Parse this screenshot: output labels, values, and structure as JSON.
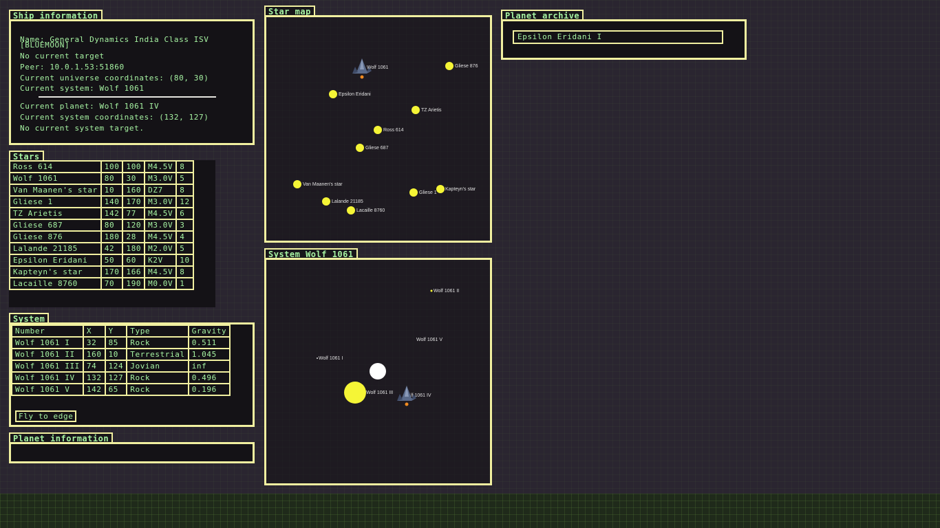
{
  "ship_info": {
    "title": "Ship information",
    "lines": [
      "Name: General Dynamics India Class ISV",
      "[BLUEMOON]",
      "No current target",
      "Peer: 10.0.1.53:51860",
      "Current universe coordinates: (80, 30)",
      "Current system: Wolf 1061",
      "Current planet: Wolf 1061 IV",
      "Current system coordinates: (132, 127)",
      "No current system target."
    ]
  },
  "stars": {
    "title": "Stars",
    "rows": [
      [
        "Ross 614",
        "100",
        "100",
        "M4.5V",
        "8"
      ],
      [
        "Wolf 1061",
        "80",
        "30",
        "M3.0V",
        "5"
      ],
      [
        "Van Maanen's star",
        "10",
        "160",
        "DZ7",
        "8"
      ],
      [
        "Gliese 1",
        "140",
        "170",
        "M3.0V",
        "12"
      ],
      [
        "TZ Arietis",
        "142",
        "77",
        "M4.5V",
        "6"
      ],
      [
        "Gliese 687",
        "80",
        "120",
        "M3.0V",
        "3"
      ],
      [
        "Gliese 876",
        "180",
        "28",
        "M4.5V",
        "4"
      ],
      [
        "Lalande 21185",
        "42",
        "180",
        "M2.0V",
        "5"
      ],
      [
        "Epsilon Eridani",
        "50",
        "60",
        "K2V",
        "10"
      ],
      [
        "Kapteyn's star",
        "170",
        "166",
        "M4.5V",
        "8"
      ],
      [
        "Lacaille 8760",
        "70",
        "190",
        "M0.0V",
        "1"
      ]
    ]
  },
  "system": {
    "title": "System",
    "headers": [
      "Number",
      "X",
      "Y",
      "Type",
      "Gravity"
    ],
    "rows": [
      [
        "Wolf 1061 I",
        "32",
        "85",
        "Rock",
        "0.511"
      ],
      [
        "Wolf 1061 II",
        "160",
        "10",
        "Terrestrial",
        "1.045"
      ],
      [
        "Wolf 1061 III",
        "74",
        "124",
        "Jovian",
        "inf"
      ],
      [
        "Wolf 1061 IV",
        "132",
        "127",
        "Rock",
        "0.496"
      ],
      [
        "Wolf 1061 V",
        "142",
        "65",
        "Rock",
        "0.196"
      ]
    ],
    "fly_button": "Fly to edge"
  },
  "planet_info": {
    "title": "Planet information"
  },
  "star_map": {
    "title": "Star map",
    "labels": {
      "wolf": "Wolf 1061",
      "gliese876": "Gliese 876",
      "epsilon": "Epsilon Eridani",
      "tz": "TZ Arietis",
      "ross": "Ross 614",
      "gliese687": "Gliese 687",
      "vanmaanen": "Van Maanen's star",
      "gliese1": "Gliese 1",
      "kapteyn": "Kapteyn's star",
      "lalande": "Lalande 21185",
      "lacaille": "Lacaille 8760"
    }
  },
  "system_map": {
    "title": "System Wolf 1061",
    "labels": {
      "p1": "Wolf 1061 I",
      "p2": "Wolf 1061 II",
      "p3": "Wolf 1061 III",
      "p4": "lf 1061 IV",
      "p5": "Wolf 1061 V"
    }
  },
  "planet_archive": {
    "title": "Planet archive",
    "items": [
      "Epsilon Eridani I"
    ]
  },
  "colors": {
    "border": "#f1f0a0",
    "text": "#a6f3a2",
    "star": "#f5f536",
    "panel_bg": "#141216"
  }
}
